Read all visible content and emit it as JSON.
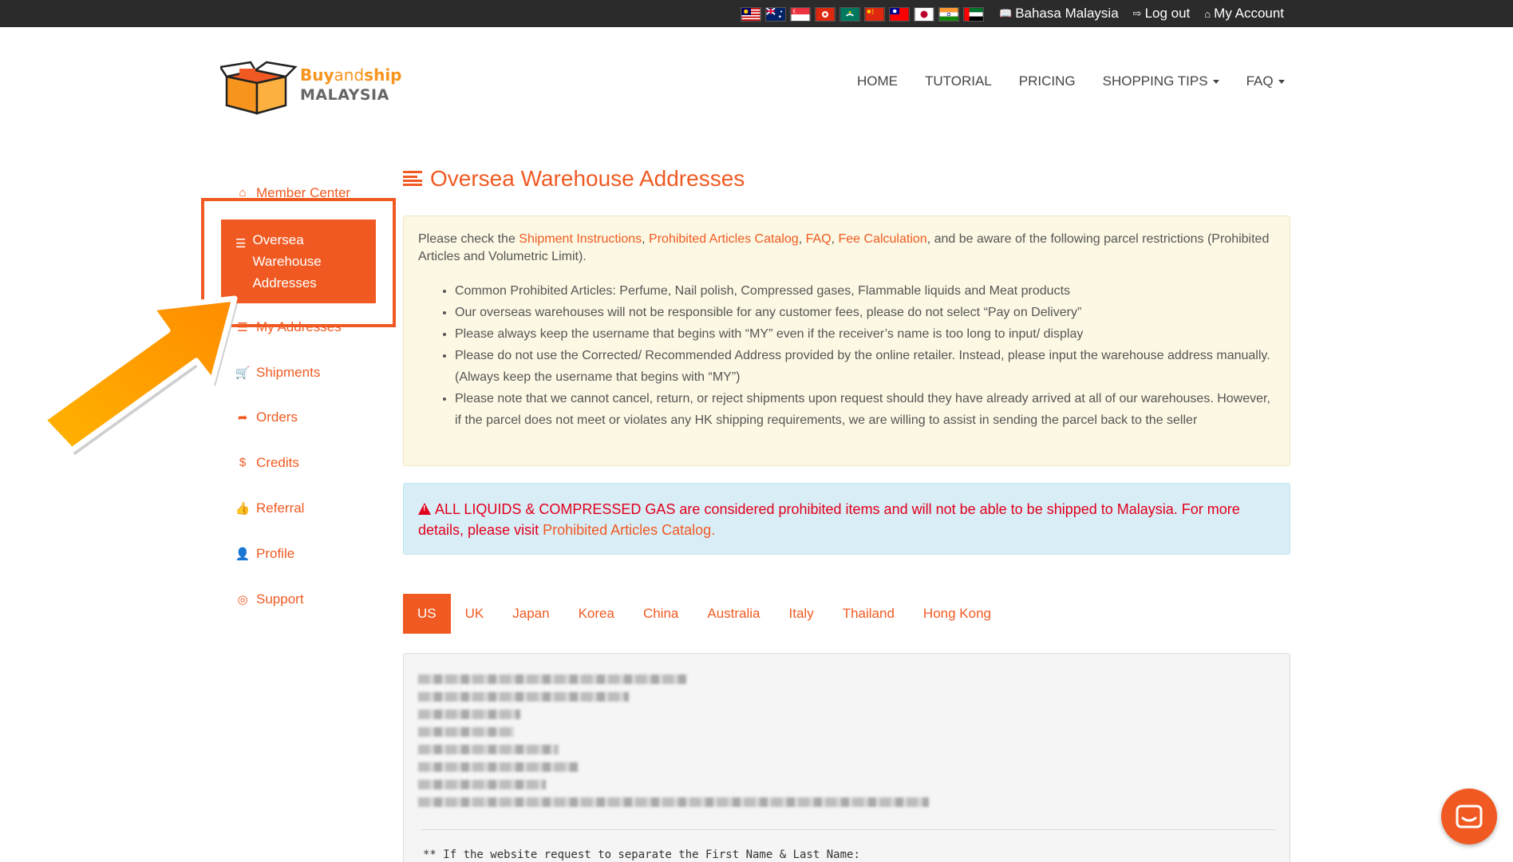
{
  "topbar": {
    "flags": [
      {
        "name": "malaysia-flag-icon",
        "colors": [
          "#cc0001",
          "#ffffff",
          "#010066",
          "#ffcc00"
        ]
      },
      {
        "name": "australia-flag-icon",
        "colors": [
          "#012169",
          "#ffffff",
          "#e4002b"
        ]
      },
      {
        "name": "singapore-flag-icon",
        "colors": [
          "#ef3340",
          "#ffffff"
        ]
      },
      {
        "name": "hong-kong-flag-icon",
        "colors": [
          "#de2910",
          "#ffffff"
        ]
      },
      {
        "name": "macau-flag-icon",
        "colors": [
          "#00785e",
          "#ffffff"
        ]
      },
      {
        "name": "china-flag-icon",
        "colors": [
          "#de2910",
          "#ffde00"
        ]
      },
      {
        "name": "taiwan-flag-icon",
        "colors": [
          "#fe0000",
          "#000095",
          "#ffffff"
        ]
      },
      {
        "name": "japan-flag-icon",
        "colors": [
          "#ffffff",
          "#bc002d"
        ]
      },
      {
        "name": "india-flag-icon",
        "colors": [
          "#ff9933",
          "#ffffff",
          "#138808"
        ]
      },
      {
        "name": "uae-flag-icon",
        "colors": [
          "#00732f",
          "#ffffff",
          "#000000",
          "#ff0000"
        ]
      }
    ],
    "language_label": "Bahasa Malaysia",
    "logout_label": "Log out",
    "account_label": "My Account"
  },
  "logo": {
    "buy": "Buy",
    "and": "and",
    "ship": "ship",
    "country": "MALAYSIA"
  },
  "nav": {
    "home": "HOME",
    "tutorial": "TUTORIAL",
    "pricing": "PRICING",
    "shopping_tips": "SHOPPING TIPS",
    "faq": "FAQ"
  },
  "sidebar": {
    "items": [
      {
        "label": "Member Center",
        "icon": "home-icon"
      },
      {
        "label": "Oversea Warehouse Addresses",
        "icon": "list-icon"
      },
      {
        "label": "My Addresses",
        "icon": "list-icon"
      },
      {
        "label": "Shipments",
        "icon": "cart-icon"
      },
      {
        "label": "Orders",
        "icon": "share-icon"
      },
      {
        "label": "Credits",
        "icon": "dollar-icon"
      },
      {
        "label": "Referral",
        "icon": "thumbs-up-icon"
      },
      {
        "label": "Profile",
        "icon": "user-icon"
      },
      {
        "label": "Support",
        "icon": "lifebuoy-icon"
      }
    ]
  },
  "main": {
    "title": "Oversea Warehouse Addresses",
    "notice": {
      "intro_prefix": "Please check the ",
      "link_instructions": "Shipment Instructions",
      "sep1": ", ",
      "link_prohibited": "Prohibited Articles Catalog",
      "sep2": ", ",
      "link_faq": "FAQ",
      "sep3": ", ",
      "link_fee": "Fee Calculation",
      "intro_suffix": ", and be aware of the following parcel restrictions (Prohibited Articles and Volumetric Limit).",
      "bullets": [
        "Common Prohibited Articles: Perfume, Nail polish, Compressed gases, Flammable liquids and Meat products",
        "Our overseas warehouses will not be responsible for any customer fees, please do not select “Pay on Delivery”",
        "Please always keep the username that begins with “MY” even if the receiver’s name is too long to input/ display",
        "Please do not use the Corrected/ Recommended Address provided by the online retailer. Instead, please input the warehouse address manually. (Always keep the username that begins with “MY”)",
        "Please note that we cannot cancel, return, or reject shipments upon request should they have already arrived at all of our warehouses. However, if the parcel does not meet or violates any HK shipping requirements, we are willing to assist in sending the parcel back to the seller"
      ]
    },
    "alert": {
      "text": "ALL LIQUIDS & COMPRESSED GAS are considered prohibited items and will not be able to be shipped to Malaysia. For more details, please visit ",
      "link": "Prohibited Articles Catalog",
      "suffix": "."
    },
    "tabs": [
      "US",
      "UK",
      "Japan",
      "Korea",
      "China",
      "Australia",
      "Italy",
      "Thailand",
      "Hong Kong"
    ],
    "active_tab": "US",
    "address_note": "** If the website request to separate the First Name & Last Name:"
  },
  "colors": {
    "accent": "#f05a22",
    "topbar": "#2b2b2b",
    "notice_bg": "#fcf8e3",
    "alert_bg": "#d9edf7",
    "alert_text": "#e0001b",
    "arrow": "#ff9800"
  }
}
